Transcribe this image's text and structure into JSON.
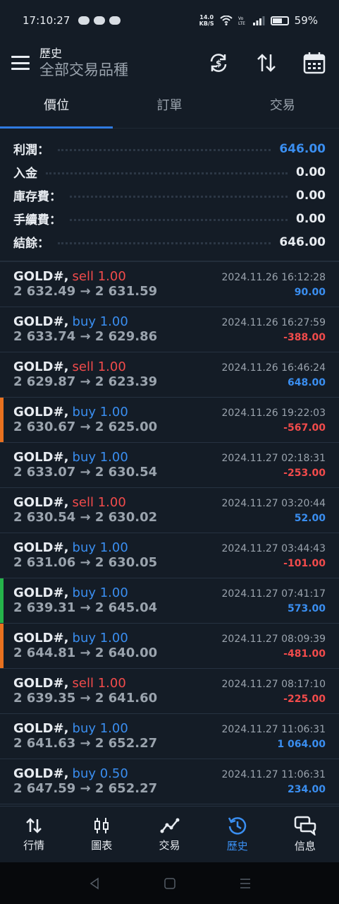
{
  "status": {
    "time": "17:10:27",
    "speed_value": "14.0",
    "speed_unit": "KB/S",
    "battery": "59%"
  },
  "header": {
    "title": "歷史",
    "subtitle": "全部交易品種"
  },
  "tabs": [
    {
      "label": "價位",
      "active": true
    },
    {
      "label": "訂單",
      "active": false
    },
    {
      "label": "交易",
      "active": false
    }
  ],
  "summary": {
    "profit_label": "利潤：",
    "profit_value": "646.00",
    "deposit_label": "入金",
    "deposit_value": "0.00",
    "swap_label": "庫存費：",
    "swap_value": "0.00",
    "commission_label": "手續費：",
    "commission_value": "0.00",
    "balance_label": "結餘：",
    "balance_value": "646.00"
  },
  "deals": [
    {
      "symbol": "GOLD#,",
      "side": "sell 1.00",
      "dir": "sell",
      "prices": "2 632.49 → 2 631.59",
      "time": "2024.11.26 16:12:28",
      "profit": "90.00",
      "sign": "pos",
      "marker": ""
    },
    {
      "symbol": "GOLD#,",
      "side": "buy 1.00",
      "dir": "buy",
      "prices": "2 633.74 → 2 629.86",
      "time": "2024.11.26 16:27:59",
      "profit": "-388.00",
      "sign": "neg",
      "marker": ""
    },
    {
      "symbol": "GOLD#,",
      "side": "sell 1.00",
      "dir": "sell",
      "prices": "2 629.87 → 2 623.39",
      "time": "2024.11.26 16:46:24",
      "profit": "648.00",
      "sign": "pos",
      "marker": ""
    },
    {
      "symbol": "GOLD#,",
      "side": "buy 1.00",
      "dir": "buy",
      "prices": "2 630.67 → 2 625.00",
      "time": "2024.11.26 19:22:03",
      "profit": "-567.00",
      "sign": "neg",
      "marker": "#e8711f"
    },
    {
      "symbol": "GOLD#,",
      "side": "buy 1.00",
      "dir": "buy",
      "prices": "2 633.07 → 2 630.54",
      "time": "2024.11.27 02:18:31",
      "profit": "-253.00",
      "sign": "neg",
      "marker": ""
    },
    {
      "symbol": "GOLD#,",
      "side": "sell 1.00",
      "dir": "sell",
      "prices": "2 630.54 → 2 630.02",
      "time": "2024.11.27 03:20:44",
      "profit": "52.00",
      "sign": "pos",
      "marker": ""
    },
    {
      "symbol": "GOLD#,",
      "side": "buy 1.00",
      "dir": "buy",
      "prices": "2 631.06 → 2 630.05",
      "time": "2024.11.27 03:44:43",
      "profit": "-101.00",
      "sign": "neg",
      "marker": ""
    },
    {
      "symbol": "GOLD#,",
      "side": "buy 1.00",
      "dir": "buy",
      "prices": "2 639.31 → 2 645.04",
      "time": "2024.11.27 07:41:17",
      "profit": "573.00",
      "sign": "pos",
      "marker": "#25b34a"
    },
    {
      "symbol": "GOLD#,",
      "side": "buy 1.00",
      "dir": "buy",
      "prices": "2 644.81 → 2 640.00",
      "time": "2024.11.27 08:09:39",
      "profit": "-481.00",
      "sign": "neg",
      "marker": "#e8711f"
    },
    {
      "symbol": "GOLD#,",
      "side": "sell 1.00",
      "dir": "sell",
      "prices": "2 639.35 → 2 641.60",
      "time": "2024.11.27 08:17:10",
      "profit": "-225.00",
      "sign": "neg",
      "marker": ""
    },
    {
      "symbol": "GOLD#,",
      "side": "buy 1.00",
      "dir": "buy",
      "prices": "2 641.63 → 2 652.27",
      "time": "2024.11.27 11:06:31",
      "profit": "1 064.00",
      "sign": "pos",
      "marker": ""
    },
    {
      "symbol": "GOLD#,",
      "side": "buy 0.50",
      "dir": "buy",
      "prices": "2 647.59 → 2 652.27",
      "time": "2024.11.27 11:06:31",
      "profit": "234.00",
      "sign": "pos",
      "marker": ""
    }
  ],
  "bottom_nav": [
    {
      "label": "行情",
      "icon": "quotes-icon",
      "active": false
    },
    {
      "label": "圖表",
      "icon": "chart-icon",
      "active": false
    },
    {
      "label": "交易",
      "icon": "trade-icon",
      "active": false
    },
    {
      "label": "歷史",
      "icon": "history-icon",
      "active": true
    },
    {
      "label": "信息",
      "icon": "messages-icon",
      "active": false
    }
  ],
  "colors": {
    "buy": "#3a8ef0",
    "sell": "#f24b4b",
    "positive": "#3a8ef0",
    "negative": "#f24b4b",
    "accent": "#2f7be0"
  }
}
